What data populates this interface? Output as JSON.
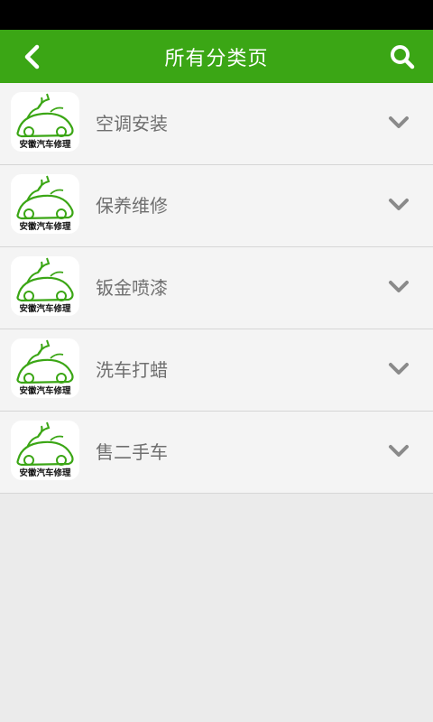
{
  "colors": {
    "header_bg": "#3ba615",
    "status_bar": "#000000",
    "row_bg": "#f4f4f4",
    "page_bg": "#ebebeb",
    "text": "#6f6f6f",
    "chevron": "#8a8a8a"
  },
  "header": {
    "title": "所有分类页",
    "back_icon": "chevron-left-icon",
    "search_icon": "search-icon"
  },
  "logo_text": "安徽汽车修理",
  "categories": [
    {
      "label": "空调安装"
    },
    {
      "label": "保养维修"
    },
    {
      "label": "钣金喷漆"
    },
    {
      "label": "洗车打蜡"
    },
    {
      "label": "售二手车"
    }
  ]
}
